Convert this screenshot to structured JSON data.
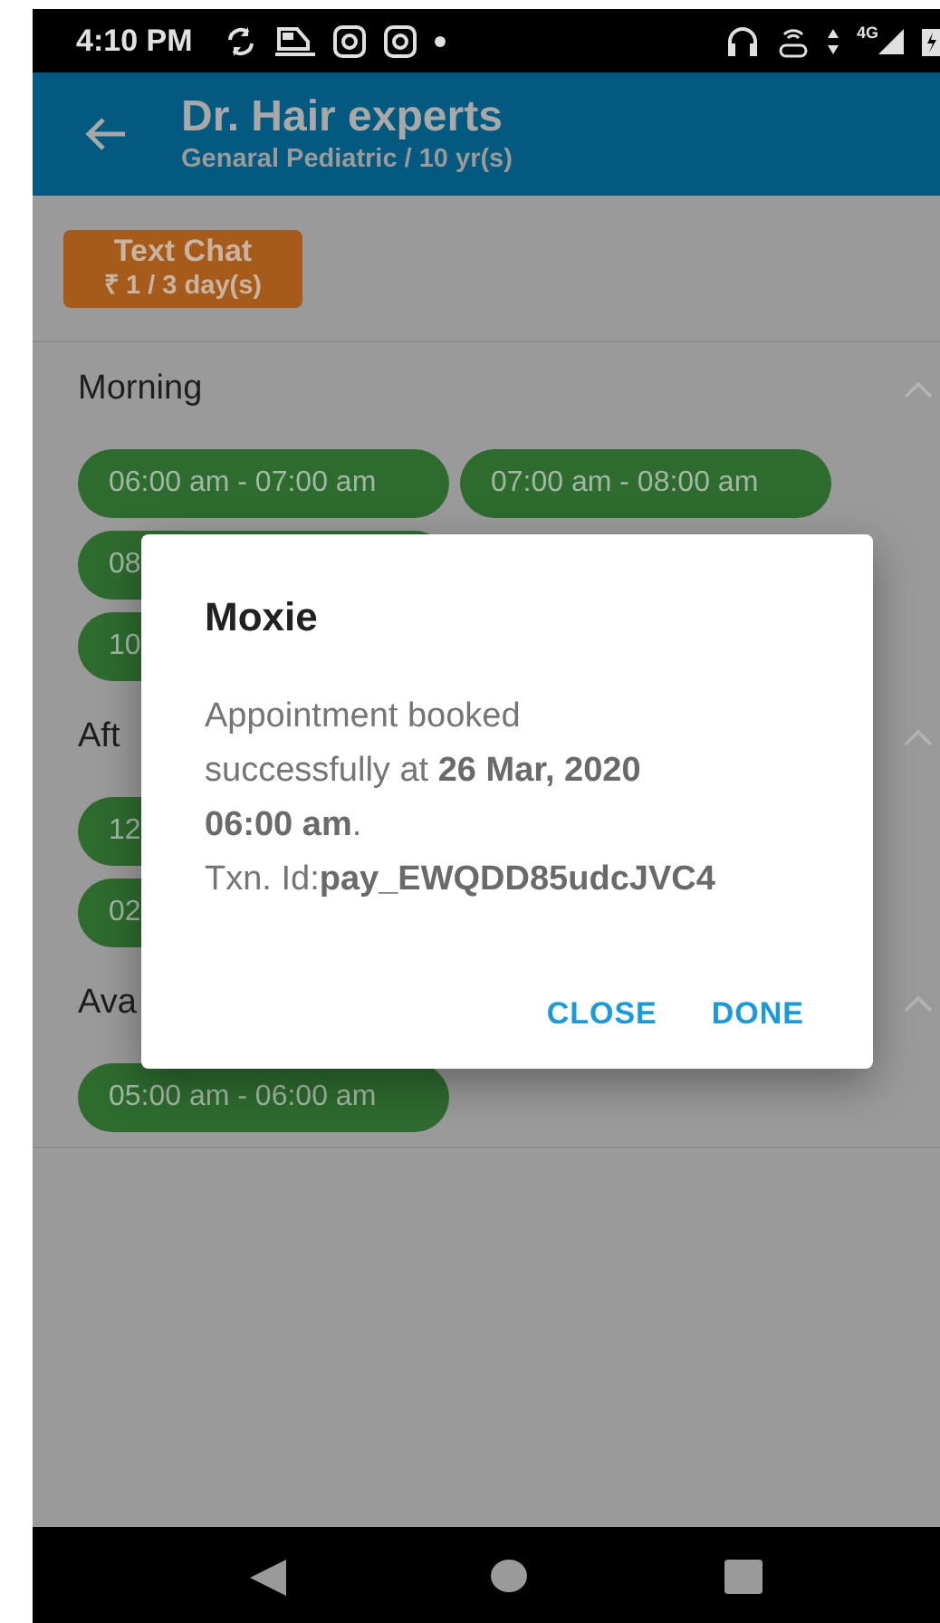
{
  "status_bar": {
    "time": "4:10 PM",
    "network": "4G"
  },
  "app_bar": {
    "title": "Dr. Hair experts",
    "subtitle": "Genaral Pediatric / 10 yr(s)"
  },
  "consult_badge": {
    "label": "Text Chat",
    "price": "₹ 1 / 3 day(s)"
  },
  "sections": [
    {
      "title": "Morning",
      "expanded": true,
      "rows": [
        [
          "06:00 am - 07:00 am",
          "07:00 am - 08:00 am"
        ],
        [
          "08"
        ],
        [
          "10"
        ]
      ]
    },
    {
      "title": "Aft",
      "expanded": true,
      "rows": [
        [
          "12"
        ],
        [
          "02"
        ]
      ]
    },
    {
      "title": "Ava",
      "expanded": true,
      "rows": [
        [
          "05:00 am - 06:00 am"
        ]
      ]
    }
  ],
  "dialog": {
    "title": "Moxie",
    "message": "Appointment booked\nsuccessfully at **26 Mar, 2020**\n**06:00 am**.\nTxn. Id:**pay_EWQDD85udcJVC4**",
    "buttons": [
      "CLOSE",
      "DONE"
    ]
  }
}
